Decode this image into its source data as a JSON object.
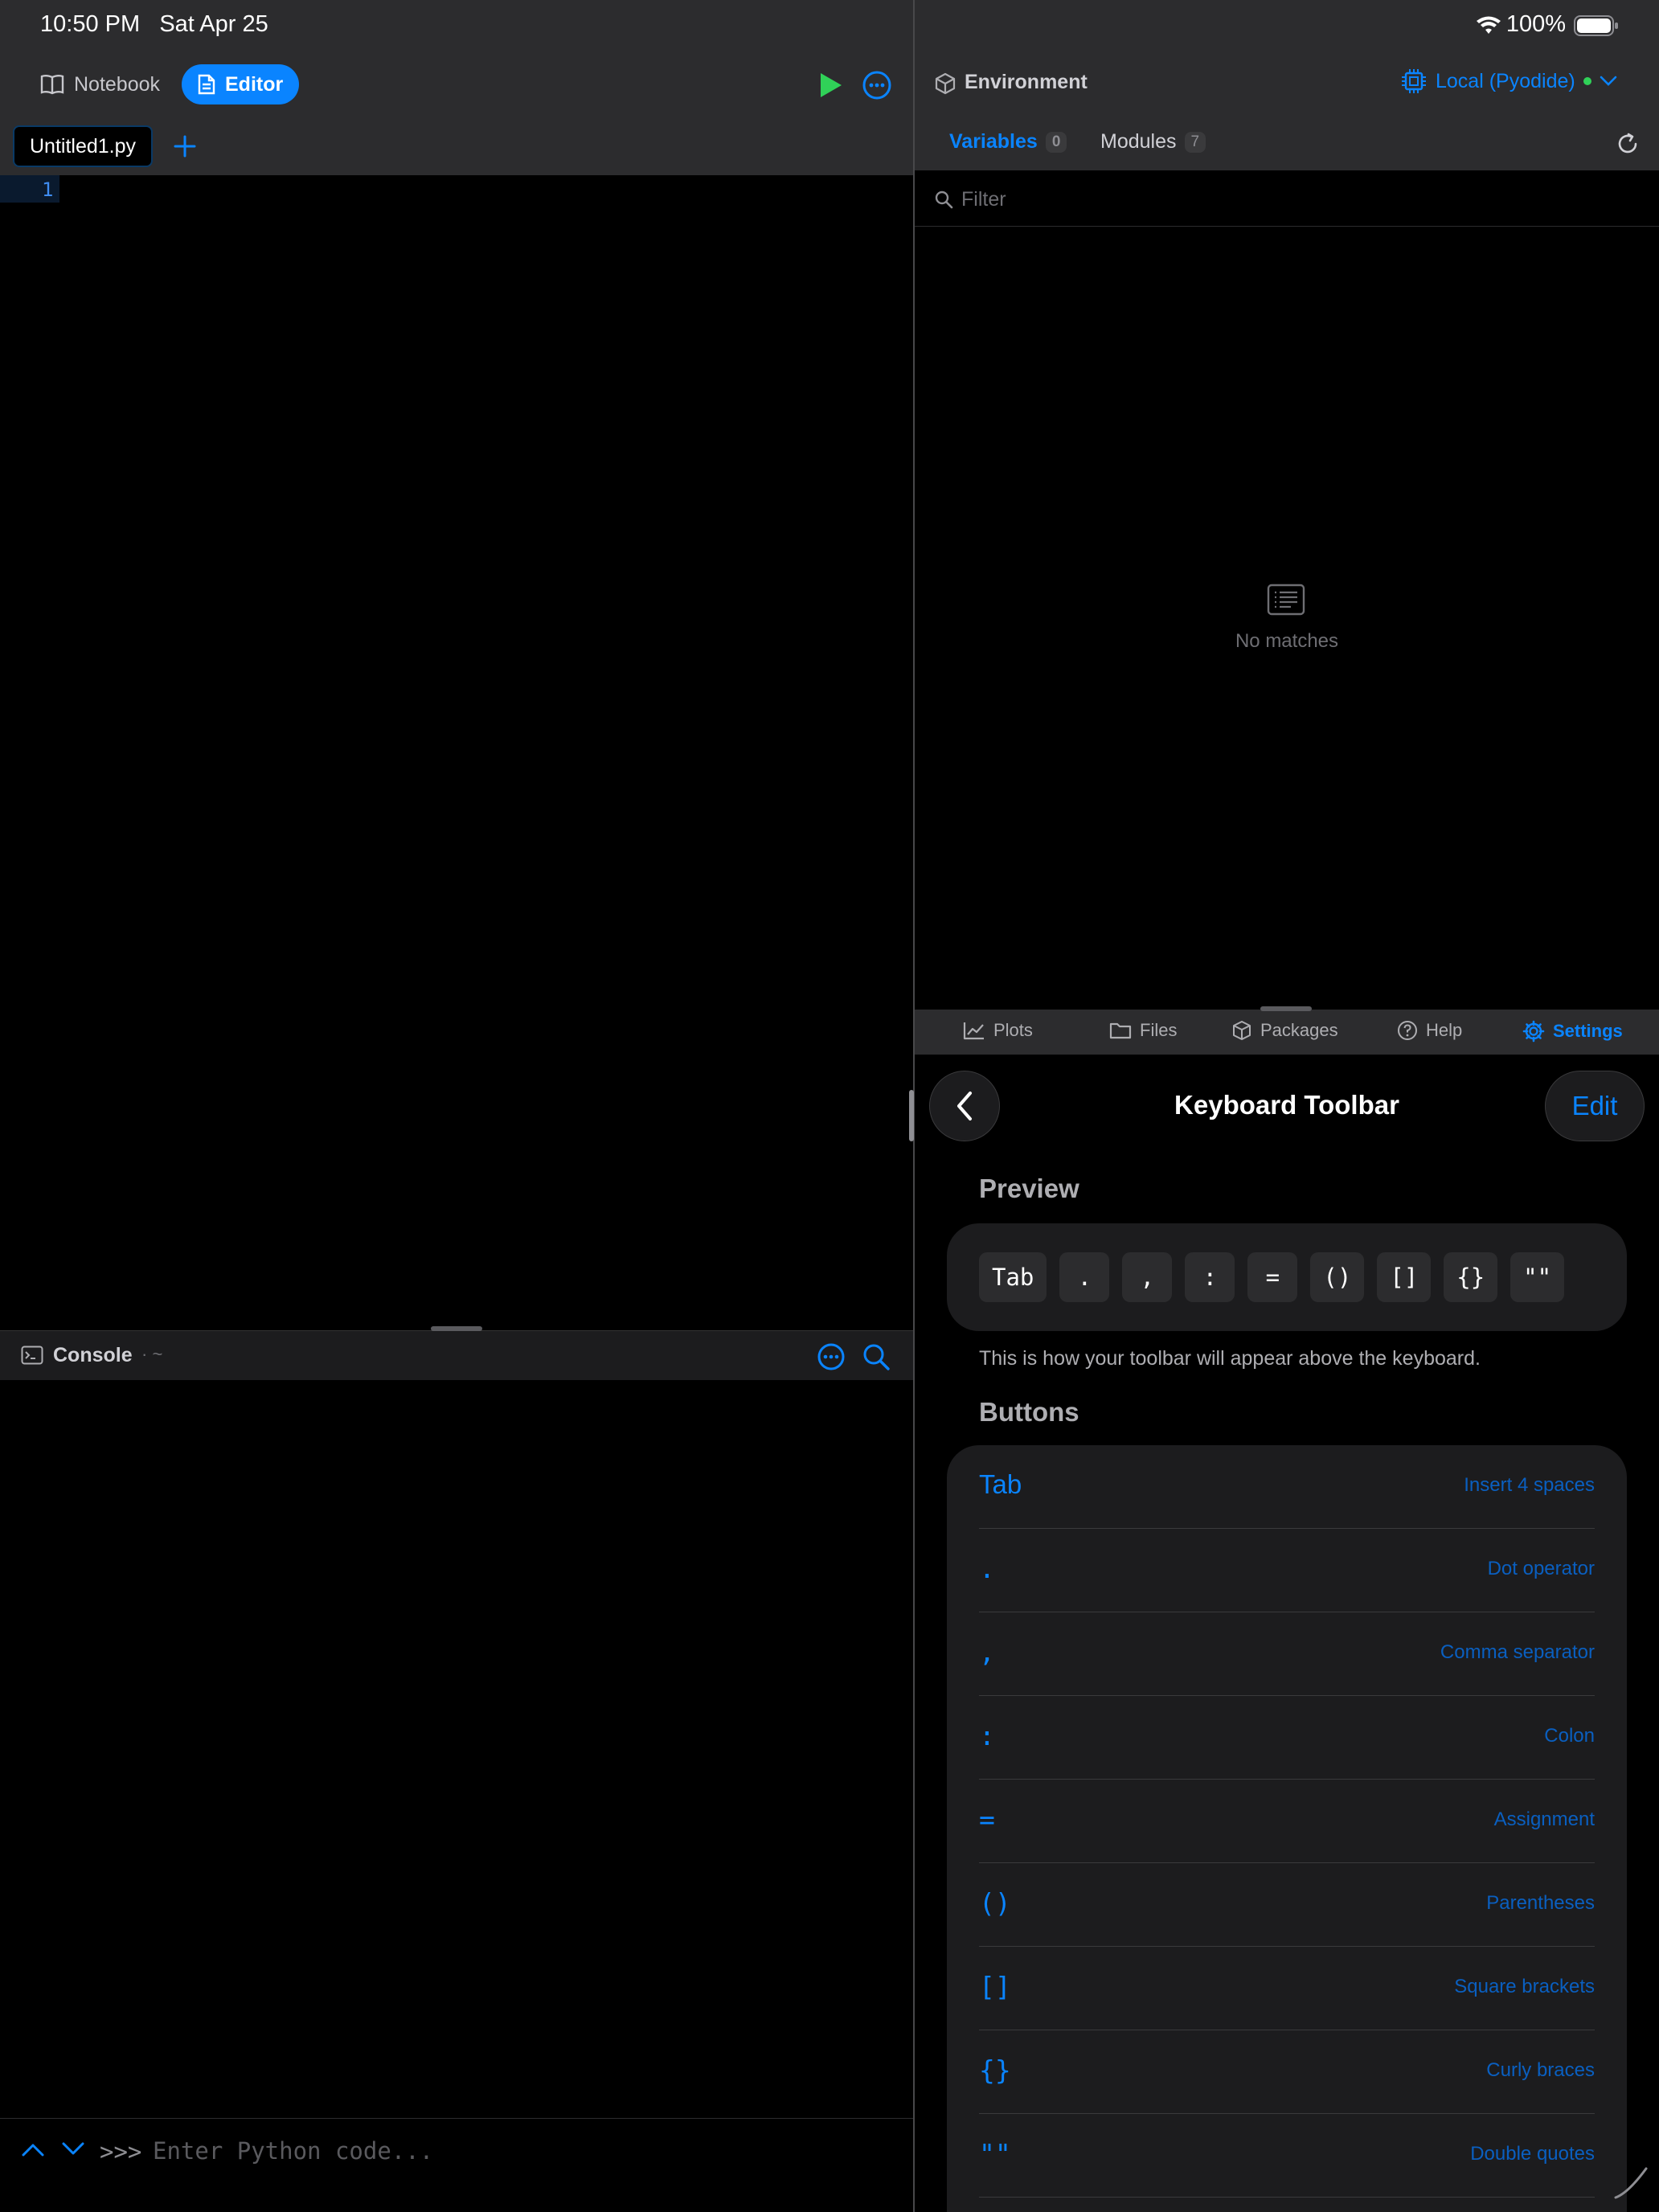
{
  "status_bar": {
    "time": "10:50 PM",
    "date": "Sat Apr 25",
    "battery": "100%"
  },
  "editor_toolbar": {
    "notebook_label": "Notebook",
    "editor_label": "Editor"
  },
  "file_tabs": {
    "active": "Untitled1.py"
  },
  "editor": {
    "line_number": "1"
  },
  "console": {
    "title": "Console",
    "path": "· ~",
    "prompt": ">>>",
    "placeholder": "Enter Python code..."
  },
  "environment": {
    "title": "Environment",
    "kernel": "Local (Pyodide)",
    "tabs": [
      {
        "label": "Variables",
        "count": "0"
      },
      {
        "label": "Modules",
        "count": "7"
      }
    ],
    "filter_placeholder": "Filter",
    "empty_text": "No matches"
  },
  "bottom_tabs": [
    {
      "label": "Plots",
      "icon": "chart-line-icon"
    },
    {
      "label": "Files",
      "icon": "folder-icon"
    },
    {
      "label": "Packages",
      "icon": "package-icon"
    },
    {
      "label": "Help",
      "icon": "help-circle-icon"
    },
    {
      "label": "Settings",
      "icon": "gear-icon"
    }
  ],
  "settings": {
    "title": "Keyboard Toolbar",
    "edit_label": "Edit",
    "preview_header": "Preview",
    "preview_keys": [
      "Tab",
      ".",
      ",",
      ":",
      "=",
      "()",
      "[]",
      "{}",
      "\"\""
    ],
    "preview_caption": "This is how your toolbar will appear above the keyboard.",
    "buttons_header": "Buttons",
    "buttons": [
      {
        "symbol": "Tab",
        "description": "Insert 4 spaces"
      },
      {
        "symbol": ".",
        "description": "Dot operator"
      },
      {
        "symbol": ",",
        "description": "Comma separator"
      },
      {
        "symbol": ":",
        "description": "Colon"
      },
      {
        "symbol": "=",
        "description": "Assignment"
      },
      {
        "symbol": "()",
        "description": "Parentheses"
      },
      {
        "symbol": "[]",
        "description": "Square brackets"
      },
      {
        "symbol": "{}",
        "description": "Curly braces"
      },
      {
        "symbol": "\"\"",
        "description": "Double quotes"
      }
    ]
  },
  "colors": {
    "accent": "#0a84ff",
    "run": "#30d158",
    "panel": "#2c2c2e",
    "card": "#1c1c1e"
  }
}
